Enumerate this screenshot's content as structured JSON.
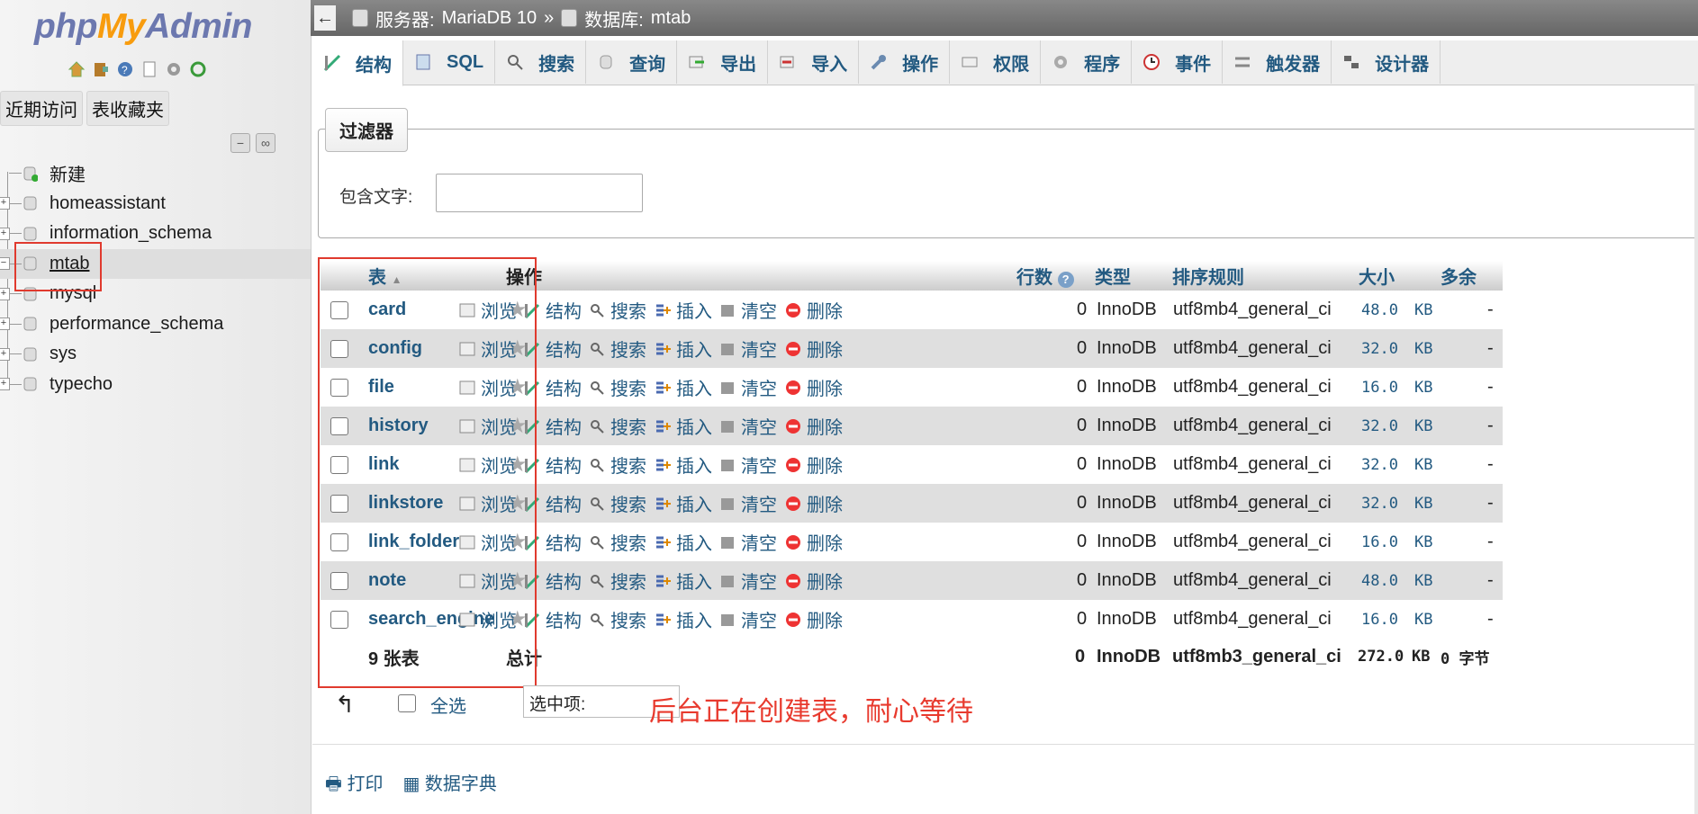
{
  "logo": {
    "part1": "php",
    "part2": "My",
    "part3": "Admin"
  },
  "nav": {
    "tabs": [
      "近期访问",
      "表收藏夹"
    ],
    "tree": [
      {
        "label": "新建",
        "type": "new"
      },
      {
        "label": "homeassistant",
        "type": "db"
      },
      {
        "label": "information_schema",
        "type": "db"
      },
      {
        "label": "mtab",
        "type": "db",
        "selected": true
      },
      {
        "label": "mysql",
        "type": "db"
      },
      {
        "label": "performance_schema",
        "type": "db"
      },
      {
        "label": "sys",
        "type": "db"
      },
      {
        "label": "typecho",
        "type": "db"
      }
    ]
  },
  "breadcrumb": {
    "server_label": "服务器:",
    "server": "MariaDB 10",
    "sep": "»",
    "db_label": "数据库:",
    "db": "mtab"
  },
  "menu": [
    "结构",
    "SQL",
    "搜索",
    "查询",
    "导出",
    "导入",
    "操作",
    "权限",
    "程序",
    "事件",
    "触发器",
    "设计器"
  ],
  "filter": {
    "legend": "过滤器",
    "label": "包含文字:",
    "value": ""
  },
  "table": {
    "headers": {
      "table": "表",
      "actions": "操作",
      "rows": "行数",
      "type": "类型",
      "collation": "排序规则",
      "size": "大小",
      "overhead": "多余"
    },
    "action_labels": [
      "浏览",
      "结构",
      "搜索",
      "插入",
      "清空",
      "删除"
    ],
    "rows": [
      {
        "name": "card",
        "rows": "0",
        "type": "InnoDB",
        "collation": "utf8mb4_general_ci",
        "size": "48.0",
        "unit": "KB",
        "overhead": "-"
      },
      {
        "name": "config",
        "rows": "0",
        "type": "InnoDB",
        "collation": "utf8mb4_general_ci",
        "size": "32.0",
        "unit": "KB",
        "overhead": "-"
      },
      {
        "name": "file",
        "rows": "0",
        "type": "InnoDB",
        "collation": "utf8mb4_general_ci",
        "size": "16.0",
        "unit": "KB",
        "overhead": "-"
      },
      {
        "name": "history",
        "rows": "0",
        "type": "InnoDB",
        "collation": "utf8mb4_general_ci",
        "size": "32.0",
        "unit": "KB",
        "overhead": "-"
      },
      {
        "name": "link",
        "rows": "0",
        "type": "InnoDB",
        "collation": "utf8mb4_general_ci",
        "size": "32.0",
        "unit": "KB",
        "overhead": "-"
      },
      {
        "name": "linkstore",
        "rows": "0",
        "type": "InnoDB",
        "collation": "utf8mb4_general_ci",
        "size": "32.0",
        "unit": "KB",
        "overhead": "-"
      },
      {
        "name": "link_folder",
        "rows": "0",
        "type": "InnoDB",
        "collation": "utf8mb4_general_ci",
        "size": "16.0",
        "unit": "KB",
        "overhead": "-"
      },
      {
        "name": "note",
        "rows": "0",
        "type": "InnoDB",
        "collation": "utf8mb4_general_ci",
        "size": "48.0",
        "unit": "KB",
        "overhead": "-"
      },
      {
        "name": "search_engine",
        "rows": "0",
        "type": "InnoDB",
        "collation": "utf8mb4_general_ci",
        "size": "16.0",
        "unit": "KB",
        "overhead": "-"
      }
    ],
    "footer": {
      "count": "9 张表",
      "total": "总计",
      "rows": "0",
      "type": "InnoDB",
      "collation": "utf8mb3_general_ci",
      "size": "272.0",
      "unit": "KB",
      "overhead": "0 字节"
    }
  },
  "bulk": {
    "select_all": "全选",
    "with_selected": "选中项:"
  },
  "annotation": "后台正在创建表，耐心等待",
  "bottom": {
    "print": "打印",
    "dictionary": "数据字典"
  },
  "colors": {
    "link": "#235a81",
    "annotation": "#e83a2e"
  }
}
